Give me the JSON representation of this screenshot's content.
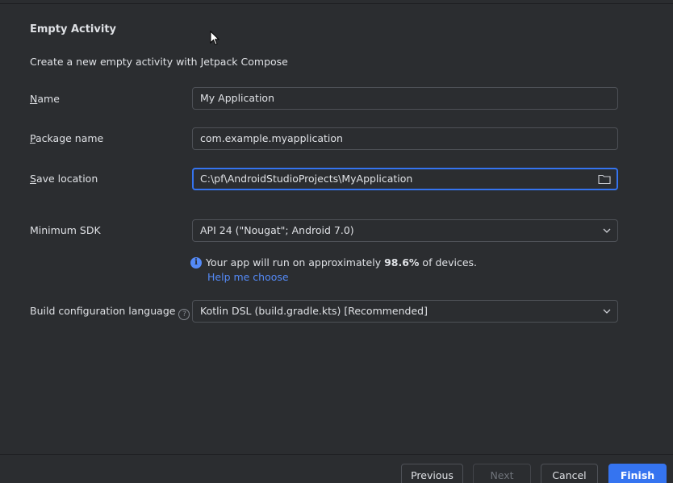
{
  "header": {
    "title": "Empty Activity",
    "description": "Create a new empty activity with Jetpack Compose"
  },
  "form": {
    "name": {
      "label_mnemonic": "N",
      "label_rest": "ame",
      "value": "My Application"
    },
    "package_name": {
      "label_mnemonic": "P",
      "label_rest": "ackage name",
      "value": "com.example.myapplication"
    },
    "save_location": {
      "label_mnemonic": "S",
      "label_rest": "ave location",
      "value": "C:\\pf\\AndroidStudioProjects\\MyApplication",
      "icon": "folder-icon"
    },
    "minimum_sdk": {
      "label": "Minimum SDK",
      "selected": "API 24 (\"Nougat\"; Android 7.0)"
    },
    "sdk_info": {
      "prefix": "Your app will run on approximately ",
      "percentage": "98.6%",
      "suffix": " of devices.",
      "help_link": "Help me choose"
    },
    "build_language": {
      "label": "Build configuration language",
      "help_glyph": "?",
      "selected": "Kotlin DSL (build.gradle.kts) [Recommended]"
    }
  },
  "footer": {
    "previous": "Previous",
    "next": "Next",
    "cancel": "Cancel",
    "finish": "Finish"
  },
  "colors": {
    "background": "#2b2d30",
    "accent": "#3574f0",
    "link": "#548af7",
    "border": "#4e5157"
  }
}
